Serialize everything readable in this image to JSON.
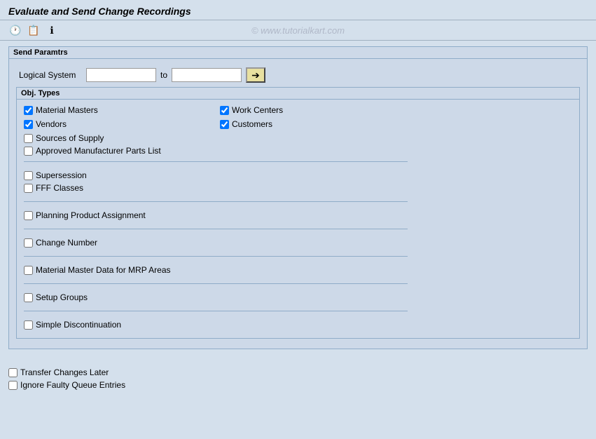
{
  "title": "Evaluate and Send Change Recordings",
  "toolbar": {
    "watermark": "© www.tutorialkart.com",
    "icons": [
      "clock-icon",
      "copy-icon",
      "info-icon"
    ]
  },
  "sendParams": {
    "legend": "Send Paramtrs",
    "logicalSystemLabel": "Logical System",
    "toLabel": "to",
    "fromValue": "",
    "toValue": "",
    "sendButtonIcon": "➔"
  },
  "objTypes": {
    "legend": "Obj. Types",
    "checkboxes": [
      {
        "id": "materialMasters",
        "label": "Material Masters",
        "checked": true,
        "col": 1
      },
      {
        "id": "workCenters",
        "label": "Work Centers",
        "checked": true,
        "col": 2
      },
      {
        "id": "vendors",
        "label": "Vendors",
        "checked": true,
        "col": 1
      },
      {
        "id": "customers",
        "label": "Customers",
        "checked": true,
        "col": 2
      },
      {
        "id": "sourcesOfSupply",
        "label": "Sources of Supply",
        "checked": false,
        "col": 1
      },
      {
        "id": "approvedMfgParts",
        "label": "Approved Manufacturer Parts List",
        "checked": false,
        "col": 1
      }
    ]
  },
  "group2": {
    "checkboxes": [
      {
        "id": "supersession",
        "label": "Supersession",
        "checked": false
      },
      {
        "id": "fffClasses",
        "label": "FFF Classes",
        "checked": false
      }
    ]
  },
  "group3": {
    "checkboxes": [
      {
        "id": "planningProductAssignment",
        "label": "Planning Product Assignment",
        "checked": false
      }
    ]
  },
  "group4": {
    "checkboxes": [
      {
        "id": "changeNumber",
        "label": "Change Number",
        "checked": false
      }
    ]
  },
  "group5": {
    "checkboxes": [
      {
        "id": "materialMasterMRP",
        "label": "Material Master Data for MRP Areas",
        "checked": false
      }
    ]
  },
  "group6": {
    "checkboxes": [
      {
        "id": "setupGroups",
        "label": "Setup Groups",
        "checked": false
      }
    ]
  },
  "group7": {
    "checkboxes": [
      {
        "id": "simpleDiscontinuation",
        "label": "Simple Discontinuation",
        "checked": false
      }
    ]
  },
  "bottomCheckboxes": [
    {
      "id": "transferChangesLater",
      "label": "Transfer Changes Later",
      "checked": false
    },
    {
      "id": "ignoreFaultyQueue",
      "label": "Ignore Faulty Queue Entries",
      "checked": false
    }
  ]
}
